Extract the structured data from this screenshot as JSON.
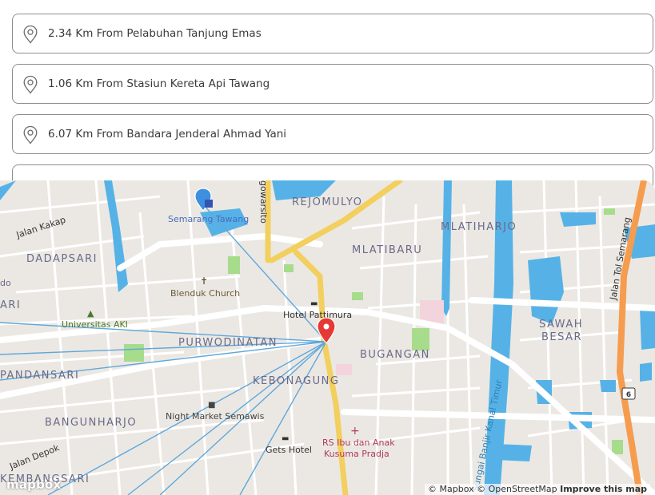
{
  "locations": [
    {
      "text": "2.34 Km From Pelabuhan Tanjung Emas"
    },
    {
      "text": "1.06 Km From Stasiun Kereta Api Tawang"
    },
    {
      "text": "6.07 Km From Bandara Jenderal Ahmad Yani"
    }
  ],
  "map": {
    "place_labels": {
      "rejomulyo": "REJOMULYO",
      "mlatibaru": "MLATIBARU",
      "mlatiharjo": "MLATIHARJO",
      "dadapsari": "DADAPSARI",
      "purwodinatan": "PURWODINATAN",
      "bugangan": "BUGANGAN",
      "kebonagung": "KEBONAGUNG",
      "sawah_besar_1": "SAWAH",
      "sawah_besar_2": "BESAR",
      "pandansari": "PANDANSARI",
      "bangunharjo": "BANGUNHARJO",
      "kembangsari": "KEMBANGSARI",
      "ari": "ARI",
      "do": "do"
    },
    "poi_labels": {
      "semarang_tawang": "Semarang Tawang",
      "blenduk_church": "Blenduk Church",
      "hotel_pattimura": "Hotel Pattimura",
      "universitas_aki": "Universitas AKI",
      "night_market": "Night Market Semawis",
      "gets_hotel": "Gets Hotel",
      "rs_1": "RS Ibu dan Anak",
      "rs_2": "Kusuma Pradja"
    },
    "street_labels": {
      "jalan_kakap": "Jalan Kakap",
      "jalan_depok": "Jalan Depok",
      "gowarsito": "gowarsito",
      "sungai_banjir": "Sungai Banjir Kanal Timur",
      "jalan_tol": "Jalan Tol Semarang"
    },
    "road_shield": "6",
    "attribution": {
      "mapbox": "© Mapbox",
      "osm": "© OpenStreetMap",
      "improve": "Improve this map"
    },
    "logo": "mapbox",
    "colors": {
      "water": "#56b2e6",
      "road_primary": "#f2cf5e",
      "motorway": "#f59c4f",
      "park": "#a6dc8c",
      "land": "#ebe8e3",
      "marker": "#e53935"
    }
  }
}
